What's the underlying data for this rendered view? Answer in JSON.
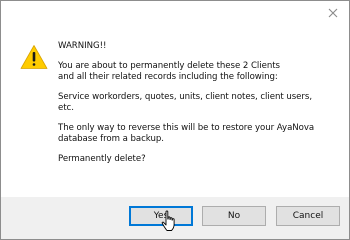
{
  "dialog": {
    "heading": "WARNING!!",
    "para1": "You are about to permanently delete these 2 Clients\nand all their related records including the following:",
    "para2": "Service workorders, quotes, units, client notes, client users,\netc.",
    "para3": "The only way to reverse this will be to restore your AyaNova\ndatabase from a backup.",
    "para4": "Permanently delete?",
    "icon": "warning-icon",
    "close_icon": "close-icon"
  },
  "buttons": {
    "yes": "Yes",
    "no": "No",
    "cancel": "Cancel"
  },
  "colors": {
    "warning_fill": "#ffcc00",
    "footer_bg": "#f0f0f0",
    "default_button_border": "#0078d7"
  }
}
